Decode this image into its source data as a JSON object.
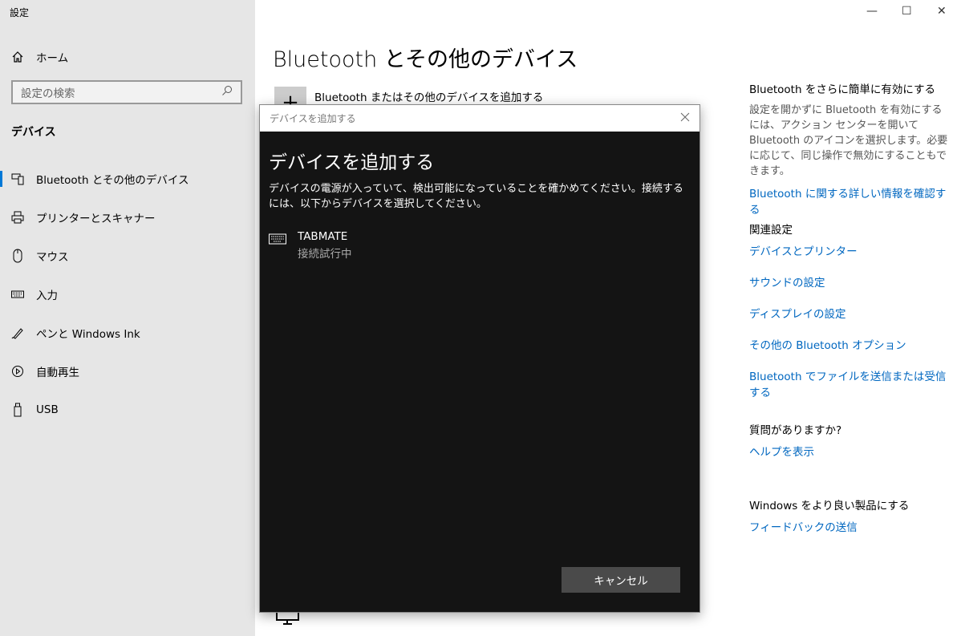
{
  "app_title": "設定",
  "sidebar": {
    "home": "ホーム",
    "search_placeholder": "設定の検索",
    "section": "デバイス",
    "items": [
      {
        "label": "Bluetooth とその他のデバイス",
        "icon": "bluetooth-devices-icon"
      },
      {
        "label": "プリンターとスキャナー",
        "icon": "printer-icon"
      },
      {
        "label": "マウス",
        "icon": "mouse-icon"
      },
      {
        "label": "入力",
        "icon": "keyboard-icon"
      },
      {
        "label": "ペンと Windows Ink",
        "icon": "pen-icon"
      },
      {
        "label": "自動再生",
        "icon": "autoplay-icon"
      },
      {
        "label": "USB",
        "icon": "usb-icon"
      }
    ]
  },
  "main": {
    "title": "Bluetooth とその他のデバイス",
    "add_device": "Bluetooth またはその他のデバイスを追加する"
  },
  "right": {
    "h1": "Bluetooth をさらに簡単に有効にする",
    "p1": "設定を開かずに Bluetooth を有効にするには、アクション センターを開いて Bluetooth のアイコンを選択します。必要に応じて、同じ操作で無効にすることもできます。",
    "link1": "Bluetooth に関する詳しい情報を確認する",
    "h2": "関連設定",
    "related": [
      "デバイスとプリンター",
      "サウンドの設定",
      "ディスプレイの設定",
      "その他の Bluetooth オプション",
      "Bluetooth でファイルを送信または受信する"
    ],
    "h3": "質問がありますか?",
    "help": "ヘルプを表示",
    "h4": "Windows をより良い製品にする",
    "feedback": "フィードバックの送信"
  },
  "dialog": {
    "titlebar": "デバイスを追加する",
    "heading": "デバイスを追加する",
    "description": "デバイスの電源が入っていて、検出可能になっていることを確かめてください。接続するには、以下からデバイスを選択してください。",
    "device_name": "TABMATE",
    "device_status": "接続試行中",
    "cancel": "キャンセル"
  }
}
